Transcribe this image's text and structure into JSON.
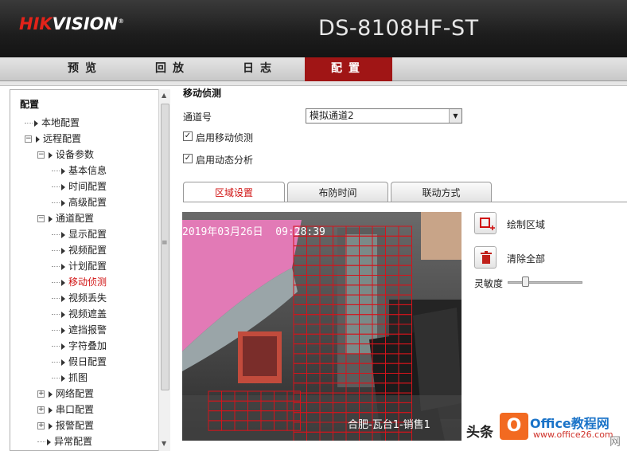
{
  "brand": {
    "logo_hik": "HIK",
    "logo_vision": "VISION",
    "model": "DS-8108HF-ST"
  },
  "nav": {
    "tabs": [
      {
        "label": "预览",
        "active": false
      },
      {
        "label": "回放",
        "active": false
      },
      {
        "label": "日志",
        "active": false
      },
      {
        "label": "配置",
        "active": true
      }
    ]
  },
  "sidebar": {
    "title": "配置",
    "items": [
      {
        "label": "本地配置",
        "level": 1,
        "kind": "leaf"
      },
      {
        "label": "远程配置",
        "level": 1,
        "kind": "expanded"
      },
      {
        "label": "设备参数",
        "level": 2,
        "kind": "expanded"
      },
      {
        "label": "基本信息",
        "level": 3,
        "kind": "leaf"
      },
      {
        "label": "时间配置",
        "level": 3,
        "kind": "leaf"
      },
      {
        "label": "高级配置",
        "level": 3,
        "kind": "leaf"
      },
      {
        "label": "通道配置",
        "level": 2,
        "kind": "expanded"
      },
      {
        "label": "显示配置",
        "level": 3,
        "kind": "leaf"
      },
      {
        "label": "视频配置",
        "level": 3,
        "kind": "leaf"
      },
      {
        "label": "计划配置",
        "level": 3,
        "kind": "leaf"
      },
      {
        "label": "移动侦测",
        "level": 3,
        "kind": "leaf",
        "active": true
      },
      {
        "label": "视频丢失",
        "level": 3,
        "kind": "leaf"
      },
      {
        "label": "视频遮盖",
        "level": 3,
        "kind": "leaf"
      },
      {
        "label": "遮挡报警",
        "level": 3,
        "kind": "leaf"
      },
      {
        "label": "字符叠加",
        "level": 3,
        "kind": "leaf"
      },
      {
        "label": "假日配置",
        "level": 3,
        "kind": "leaf"
      },
      {
        "label": "抓图",
        "level": 3,
        "kind": "leaf"
      },
      {
        "label": "网络配置",
        "level": 2,
        "kind": "collapsed"
      },
      {
        "label": "串口配置",
        "level": 2,
        "kind": "collapsed"
      },
      {
        "label": "报警配置",
        "level": 2,
        "kind": "collapsed"
      },
      {
        "label": "异常配置",
        "level": 2,
        "kind": "leaf"
      }
    ]
  },
  "main": {
    "section_title": "移动侦测",
    "channel_label": "通道号",
    "channel_value": "模拟通道2",
    "enable_motion": {
      "label": "启用移动侦测",
      "checked": true
    },
    "enable_analysis": {
      "label": "启用动态分析",
      "checked": true
    },
    "tabs": [
      {
        "label": "区域设置",
        "active": true
      },
      {
        "label": "布防时间",
        "active": false
      },
      {
        "label": "联动方式",
        "active": false
      }
    ],
    "video": {
      "osd_time": "2019年03月26日  09:28:39",
      "osd_name": "合肥-瓦台1-销售1"
    },
    "draw_area_label": "绘制区域",
    "clear_all_label": "清除全部",
    "sensitivity_label": "灵敏度",
    "sensitivity_level": 0.2
  },
  "watermark": {
    "toutiao": "头条",
    "office": "Office教程网",
    "site": "www.office26.com",
    "corner": "网"
  },
  "colors": {
    "accent": "#a01515",
    "grid": "#d4141c",
    "active_text": "#d01010"
  }
}
